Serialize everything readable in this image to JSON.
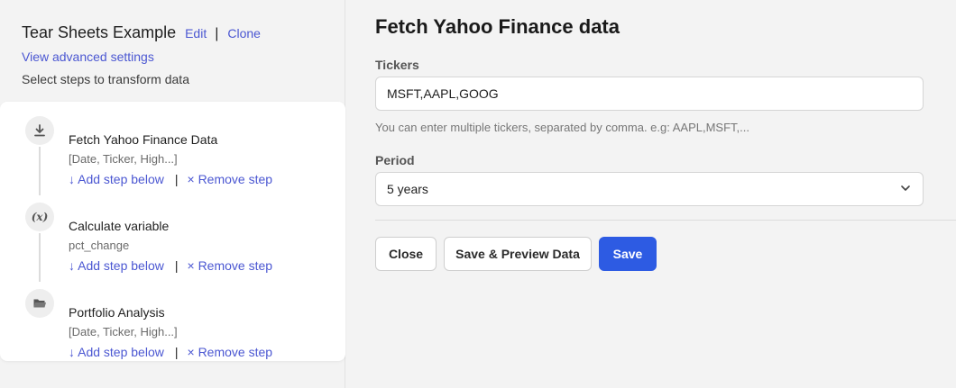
{
  "sidebar": {
    "flow_title": "Tear Sheets Example",
    "edit_link": "Edit",
    "separator": "|",
    "clone_link": "Clone",
    "advanced_link": "View advanced settings",
    "hint": "Select steps to transform data",
    "steps": [
      {
        "name": "Fetch Yahoo Finance Data",
        "detail": "[Date, Ticker, High...]",
        "icon": "download-icon"
      },
      {
        "name": "Calculate variable",
        "detail": "pct_change",
        "icon": "variable-icon"
      },
      {
        "name": "Portfolio Analysis",
        "detail": "[Date, Ticker, High...]",
        "icon": "folder-icon"
      }
    ],
    "add_step_label": "↓ Add step below",
    "remove_step_label": "× Remove step",
    "variable_glyph": "(x)"
  },
  "panel": {
    "title": "Fetch Yahoo Finance data",
    "tickers_label": "Tickers",
    "tickers_value": "MSFT,AAPL,GOOG",
    "tickers_help": "You can enter multiple tickers, separated by comma. e.g: AAPL,MSFT,...",
    "period_label": "Period",
    "period_value": "5 years",
    "close_button": "Close",
    "save_preview_button": "Save & Preview Data",
    "save_button": "Save"
  },
  "colors": {
    "link": "#4b57d2",
    "primary": "#2d5be3",
    "background": "#f3f3f3",
    "card": "#ffffff"
  }
}
